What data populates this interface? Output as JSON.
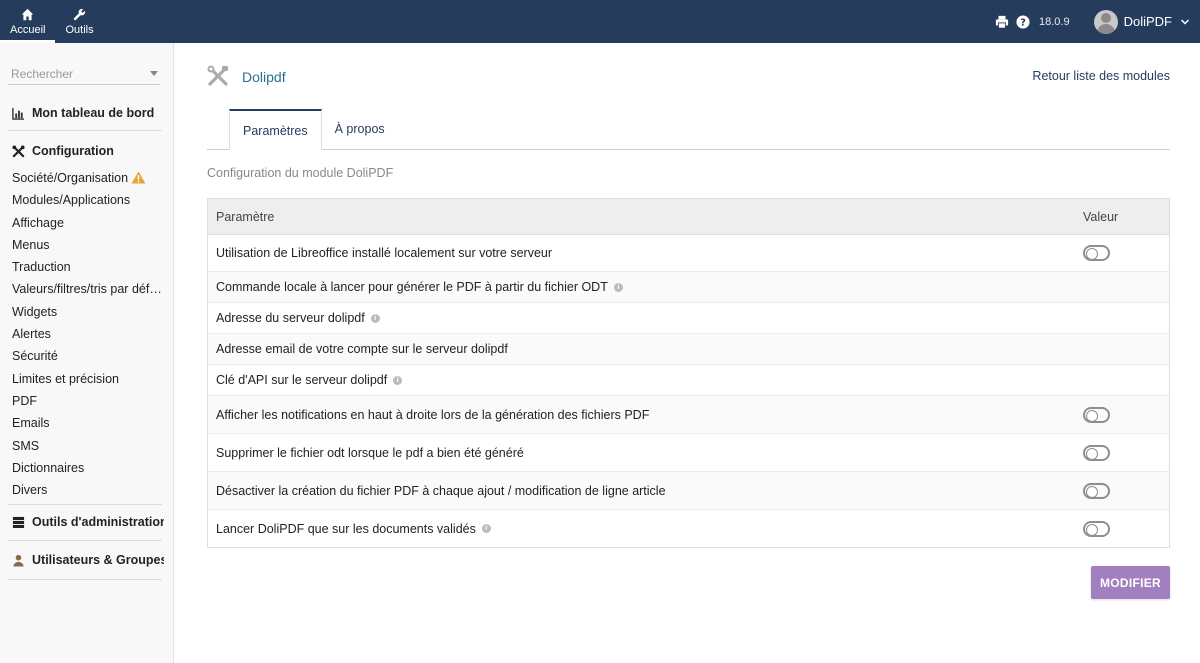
{
  "topbar": {
    "nav": [
      {
        "label": "Accueil",
        "icon": "home-icon",
        "active": true
      },
      {
        "label": "Outils",
        "icon": "wrench-icon",
        "active": false
      }
    ],
    "version": "18.0.9",
    "username": "DoliPDF"
  },
  "sidebar": {
    "search_placeholder": "Rechercher",
    "dashboard": "Mon tableau de bord",
    "configuration": "Configuration",
    "items": [
      "Société/Organisation",
      "Modules/Applications",
      "Affichage",
      "Menus",
      "Traduction",
      "Valeurs/filtres/tris par défaut",
      "Widgets",
      "Alertes",
      "Sécurité",
      "Limites et précision",
      "PDF",
      "Emails",
      "SMS",
      "Dictionnaires",
      "Divers"
    ],
    "admin_tools": "Outils d'administration",
    "users_groups": "Utilisateurs & Groupes"
  },
  "main": {
    "module_title": "Dolipdf",
    "back_link": "Retour liste des modules",
    "tabs": [
      {
        "label": "Paramètres",
        "active": true
      },
      {
        "label": "À propos",
        "active": false
      }
    ],
    "subtitle": "Configuration du module DoliPDF",
    "table": {
      "headers": [
        "Paramètre",
        "Valeur"
      ],
      "rows": [
        {
          "label": "Utilisation de Libreoffice installé localement sur votre serveur",
          "info": false,
          "toggle": true,
          "toggle_on": false
        },
        {
          "label": "Commande locale à lancer pour générer le PDF à partir du fichier ODT",
          "info": true,
          "toggle": false
        },
        {
          "label": "Adresse du serveur dolipdf",
          "info": true,
          "toggle": false
        },
        {
          "label": "Adresse email de votre compte sur le serveur dolipdf",
          "info": false,
          "toggle": false
        },
        {
          "label": "Clé d'API sur le serveur dolipdf",
          "info": true,
          "toggle": false
        },
        {
          "label": "Afficher les notifications en haut à droite lors de la génération des fichiers PDF",
          "info": false,
          "toggle": true,
          "toggle_on": false
        },
        {
          "label": "Supprimer le fichier odt lorsque le pdf a bien été généré",
          "info": false,
          "toggle": true,
          "toggle_on": false
        },
        {
          "label": "Désactiver la création du fichier PDF à chaque ajout / modification de ligne article",
          "info": false,
          "toggle": true,
          "toggle_on": false
        },
        {
          "label": "Lancer DoliPDF que sur les documents validés",
          "info": true,
          "toggle": true,
          "toggle_on": false
        }
      ]
    },
    "submit_label": "MODIFIER"
  },
  "colors": {
    "topbar": "#263c5c",
    "link": "#263c5c",
    "title": "#2a6f8f",
    "button": "#a27fbe",
    "warning": "#e8a33b"
  }
}
